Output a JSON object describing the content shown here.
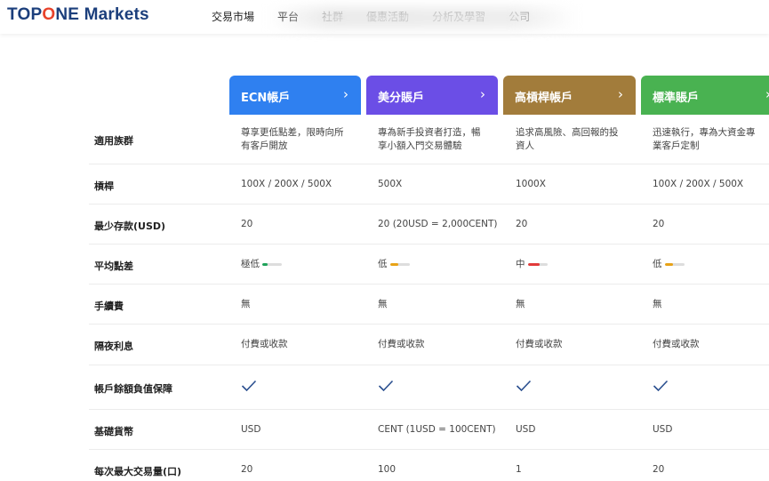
{
  "logo": {
    "prefix": "TOP",
    "accent": "O",
    "suffix": "NE Markets"
  },
  "nav": [
    "交易市場",
    "平台",
    "社群",
    "優惠活動",
    "分析及學習",
    "公司"
  ],
  "accounts": [
    {
      "name": "ECN帳戶",
      "color": "#2f80f0"
    },
    {
      "name": "美分賬戶",
      "color": "#6b4ee6"
    },
    {
      "name": "高槓桿帳戶",
      "color": "#a27c3b"
    },
    {
      "name": "標準賬戶",
      "color": "#49b251"
    }
  ],
  "rows": {
    "target": {
      "label": "適用族群",
      "values": [
        "尊享更低點差，限時向所有客戶開放",
        "專為新手投資者打造，暢享小額入門交易體驗",
        "追求高風險、高回報的投資人",
        "迅速執行，專為大資金專業客戶定制"
      ]
    },
    "leverage": {
      "label": "槓桿",
      "values": [
        "100X / 200X / 500X",
        "500X",
        "1000X",
        "100X / 200X / 500X"
      ]
    },
    "min_deposit": {
      "label": "最少存款(USD)",
      "values": [
        "20",
        "20 (20USD = 2,000CENT)",
        "20",
        "20"
      ]
    },
    "spread": {
      "label": "平均點差",
      "values": [
        "極低",
        "低",
        "中",
        "低"
      ],
      "levels": [
        0.25,
        0.45,
        0.6,
        0.45
      ],
      "colors": [
        "#1fa35a",
        "#e8a317",
        "#e23b3b",
        "#e8a317"
      ]
    },
    "commission": {
      "label": "手續費",
      "values": [
        "無",
        "無",
        "無",
        "無"
      ]
    },
    "swap": {
      "label": "隔夜利息",
      "values": [
        "付費或收款",
        "付費或收款",
        "付費或收款",
        "付費或收款"
      ]
    },
    "negative_balance": {
      "label": "帳戶餘額負值保障",
      "check_color": "#2a4f8f"
    },
    "base_currency": {
      "label": "基礎貨幣",
      "values": [
        "USD",
        "CENT (1USD = 100CENT)",
        "USD",
        "USD"
      ]
    },
    "max_volume": {
      "label": "每次最大交易量(口)",
      "values": [
        "20",
        "100",
        "1",
        "20"
      ]
    }
  }
}
